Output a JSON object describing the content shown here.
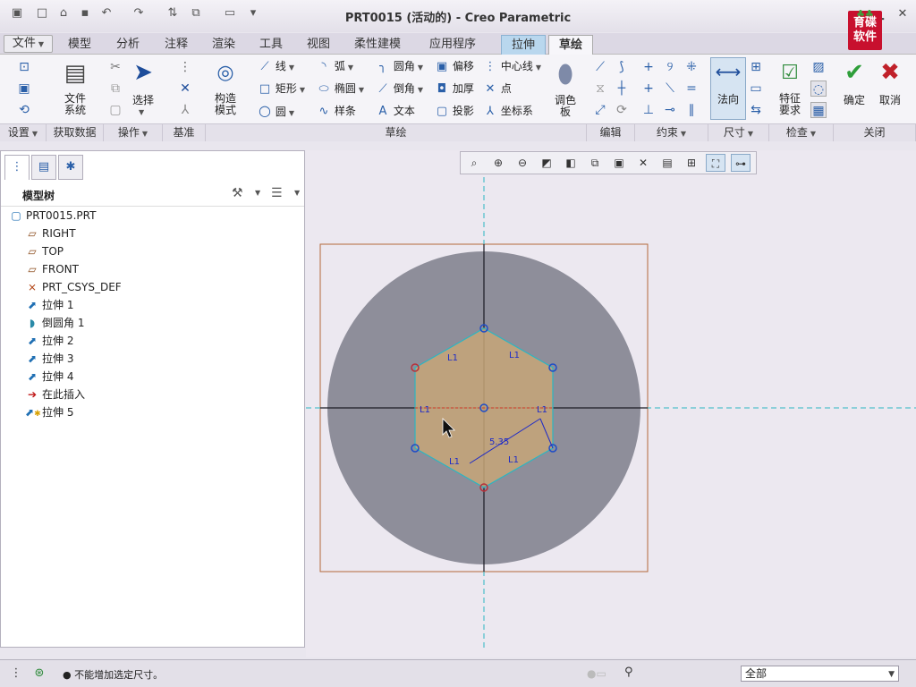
{
  "window": {
    "title": "PRT0015 (活动的) - Creo Parametric"
  },
  "logo": {
    "line1": "育碟",
    "line2": "软件"
  },
  "tabs": [
    "文件",
    "模型",
    "分析",
    "注释",
    "渲染",
    "工具",
    "视图",
    "柔性建模",
    "应用程序",
    "拉伸",
    "草绘"
  ],
  "ribbon": {
    "setup_group": "设置",
    "getdata": {
      "label": "文件\n系统",
      "group": "获取数据"
    },
    "operations": {
      "select": "选择",
      "group": "操作"
    },
    "datum": {
      "group": "基准"
    },
    "sketch": {
      "construction": "构造\n模式",
      "group": "草绘",
      "col1": [
        "线",
        "矩形",
        "圆"
      ],
      "col2": [
        "弧",
        "椭圆",
        "样条"
      ],
      "col3": [
        "圆角",
        "倒角",
        "文本"
      ],
      "col4": [
        "偏移",
        "加厚",
        "投影"
      ],
      "col5": [
        "中心线",
        "点",
        "坐标系"
      ],
      "palette": "调色\n板"
    },
    "editing_group": "编辑",
    "constrain_group": "约束",
    "dimension": {
      "normal": "法向",
      "group": "尺寸"
    },
    "inspect": {
      "requirements": "特征\n要求",
      "group": "检查"
    },
    "close": {
      "ok": "确定",
      "cancel": "取消",
      "group": "关闭"
    }
  },
  "model_tree": {
    "title": "模型树",
    "items": [
      "PRT0015.PRT",
      "RIGHT",
      "TOP",
      "FRONT",
      "PRT_CSYS_DEF",
      "拉伸 1",
      "倒圆角 1",
      "拉伸 2",
      "拉伸 3",
      "拉伸 4",
      "在此插入",
      "拉伸 5"
    ]
  },
  "sketch_labels": {
    "constraint": "L1",
    "dimension": "5.35"
  },
  "status": {
    "message": "● 不能增加选定尺寸。",
    "filter_value": "全部"
  },
  "colors": {
    "disk": "#8e8e9a",
    "hexagon": "#c7a678",
    "extrude_tab": "#b9d7ee",
    "datum_cyan": "#2bb6c2"
  }
}
